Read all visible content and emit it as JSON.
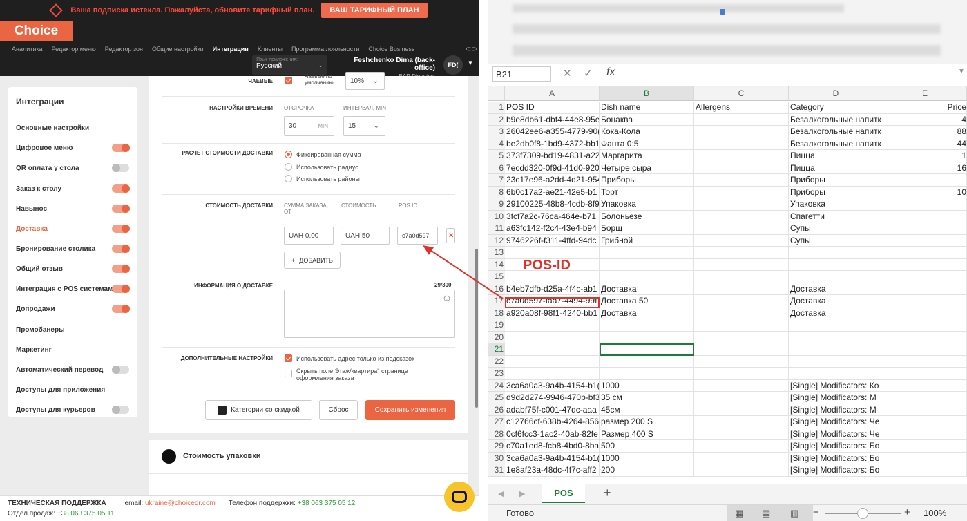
{
  "app": {
    "banner_message": "Ваша подписка истекла. Пожалуйста, обновите тарифный план.",
    "banner_button": "ВАШ ТАРИФНЫЙ ПЛАН",
    "logo": "Choice",
    "nav": [
      "Аналитика",
      "Редактор меню",
      "Редактор зон",
      "Общие настройки",
      "Интеграции",
      "Клиенты",
      "Программа лояльности",
      "Choice Business"
    ],
    "nav_active": "Интеграции",
    "lang_label": "Язык приложения:",
    "lang_value": "Русский",
    "user_name": "Feshchenko Dima (back-office)",
    "user_place": "BAR Dima test",
    "avatar": "FD("
  },
  "sidebar": {
    "title": "Интеграции",
    "items": [
      {
        "label": "Основные настройки",
        "toggle": null
      },
      {
        "label": "Цифровое меню",
        "toggle": true
      },
      {
        "label": "QR оплата у стола",
        "toggle": false
      },
      {
        "label": "Заказ к столу",
        "toggle": true
      },
      {
        "label": "Навынос",
        "toggle": true
      },
      {
        "label": "Доставка",
        "toggle": true,
        "active": true
      },
      {
        "label": "Бронирование столика",
        "toggle": true
      },
      {
        "label": "Общий отзыв",
        "toggle": true
      },
      {
        "label": "Интеграция с POS системами",
        "toggle": true
      },
      {
        "label": "Допродажи",
        "toggle": true
      },
      {
        "label": "Промобанеры",
        "toggle": null
      },
      {
        "label": "Маркетинг",
        "toggle": null
      },
      {
        "label": "Автоматический перевод",
        "toggle": false
      },
      {
        "label": "Доступы для приложения",
        "toggle": null
      },
      {
        "label": "Доступы для курьеров",
        "toggle": false
      }
    ]
  },
  "form": {
    "tips_label": "ЧАЕВЫЕ",
    "tips_default_label": "Чаевые по умолчанию",
    "tips_value": "10%",
    "time_label": "НАСТРОЙКИ ВРЕМЕНИ",
    "delay_label": "ОТСРОЧКА",
    "delay_value": "30",
    "delay_unit": "MIN",
    "interval_label": "ИНТЕРВАЛ, MIN",
    "interval_value": "15",
    "calc_label": "РАСЧЕТ СТОИМОСТИ ДОСТАВКИ",
    "calc_options": [
      "Фиксированная сумма",
      "Использовать радиус",
      "Использовать районы"
    ],
    "cost_label": "СТОИМОСТЬ ДОСТАВКИ",
    "col_order": "СУММА ЗАКАЗА, ОТ",
    "col_cost": "СТОИМОСТЬ",
    "col_pos": "POS ID",
    "order_value": "UAH 0.00",
    "cost_value": "UAH 50",
    "pos_value": "c7a0d597",
    "add_button": "ДОБАВИТЬ",
    "info_label": "ИНФОРМАЦИЯ О ДОСТАВКЕ",
    "info_count": "29/300",
    "extra_label": "ДОПОЛНИТЕЛЬНЫЕ НАСТРОЙКИ",
    "extra_1": "Использовать адрес только из подсказок",
    "extra_2": "Скрыть поле Этаж/квартира\" странице оформления заказа",
    "btn_categories": "Категории со скидкой",
    "btn_reset": "Сброс",
    "btn_save": "Сохранить изменения",
    "packaging_title": "Стоимость упаковки"
  },
  "footer": {
    "support": "ТЕХНИЧЕСКАЯ ПОДДЕРЖКА",
    "email_label": "email:",
    "email": "ukraine@choiceqr.com",
    "phone_label": "Телефон поддержки:",
    "phone": "+38 063 375 05 12",
    "sales_label": "Отдел продаж:",
    "sales_phone": "+38 063 375 05 11"
  },
  "sheet": {
    "namebox": "B21",
    "columns": [
      "A",
      "B",
      "C",
      "D",
      "E"
    ],
    "rows": [
      [
        "1",
        "POS ID",
        "Dish name",
        "Allergens",
        "Category",
        "Price"
      ],
      [
        "2",
        "b9e8db61-dbf4-44e8-95e",
        "Бонаква",
        "",
        "Безалкогольные напитк",
        "4"
      ],
      [
        "3",
        "26042ee6-a355-4779-90(",
        "Кока-Кола",
        "",
        "Безалкогольные напитк",
        "88"
      ],
      [
        "4",
        "be2db0f8-1bd9-4372-bb1",
        "Фанта 0:5",
        "",
        "Безалкогольные напитк",
        "44"
      ],
      [
        "5",
        "373f7309-bd19-4831-a22",
        "Маргарита",
        "",
        "Пицца",
        "1"
      ],
      [
        "6",
        "7ecdd320-0f9d-41d0-920",
        "Четыре сыра",
        "",
        "Пицца",
        "16"
      ],
      [
        "7",
        "23c17e96-a2dd-4d21-954",
        "Приборы",
        "",
        "Приборы",
        ""
      ],
      [
        "8",
        "6b0c17a2-ae21-42e5-b1",
        "Торт",
        "",
        "Приборы",
        "10"
      ],
      [
        "9",
        "29100225-48b8-4cdb-8f9",
        "Упаковка",
        "",
        "Упаковка",
        ""
      ],
      [
        "10",
        "3fcf7a2c-76ca-464e-b71",
        "Болоньезе",
        "",
        "Спагетти",
        ""
      ],
      [
        "11",
        "a63fc142-f2c4-43e4-b94",
        "Борщ",
        "",
        "Супы",
        ""
      ],
      [
        "12",
        "9746226f-f311-4ffd-94dc",
        "Грибной",
        "",
        "Супы",
        ""
      ],
      [
        "13",
        "",
        "",
        "",
        "",
        ""
      ],
      [
        "14",
        "",
        "",
        "",
        "",
        ""
      ],
      [
        "15",
        "",
        "",
        "",
        "",
        ""
      ],
      [
        "16",
        "b4eb7dfb-d25a-4f4c-ab1",
        "Доставка",
        "",
        "Доставка",
        ""
      ],
      [
        "17",
        "c7a0d597-faa7-4494-99f",
        "Доставка 50",
        "",
        "Доставка",
        ""
      ],
      [
        "18",
        "a920a08f-98f1-4240-bb1",
        "Доставка",
        "",
        "Доставка",
        ""
      ],
      [
        "19",
        "",
        "",
        "",
        "",
        ""
      ],
      [
        "20",
        "",
        "",
        "",
        "",
        ""
      ],
      [
        "21",
        "",
        "",
        "",
        "",
        ""
      ],
      [
        "22",
        "",
        "",
        "",
        "",
        ""
      ],
      [
        "23",
        "",
        "",
        "",
        "",
        ""
      ],
      [
        "24",
        "3ca6a0a3-9a4b-4154-b1(",
        "1000",
        "",
        "[Single] Modificators: Ко",
        ""
      ],
      [
        "25",
        "d9d2d274-9946-470b-bf3",
        "35 см",
        "",
        "[Single] Modificators: М",
        ""
      ],
      [
        "26",
        "adabf75f-c001-47dc-aaa",
        "45см",
        "",
        "[Single] Modificators: М",
        ""
      ],
      [
        "27",
        "c12766cf-638b-4264-856",
        "размер 200 S",
        "",
        "[Single] Modificators: Че",
        ""
      ],
      [
        "28",
        "0cf6fcc3-1ac2-40ab-82fe",
        "Размер 400 S",
        "",
        "[Single] Modificators: Че",
        ""
      ],
      [
        "29",
        "c70a1ed8-fcb8-4bd0-8ba",
        "500",
        "",
        "[Single] Modificators: Бо",
        ""
      ],
      [
        "30",
        "3ca6a0a3-9a4b-4154-b1(",
        "1000",
        "",
        "[Single] Modificators: Бо",
        ""
      ],
      [
        "31",
        "1e8af23a-48dc-4f7c-aff2",
        "200",
        "",
        "[Single] Modificators: Бо",
        ""
      ]
    ],
    "sheet_tab": "POS",
    "status": "Готово",
    "zoom": "100%",
    "annotation": "POS-ID"
  }
}
